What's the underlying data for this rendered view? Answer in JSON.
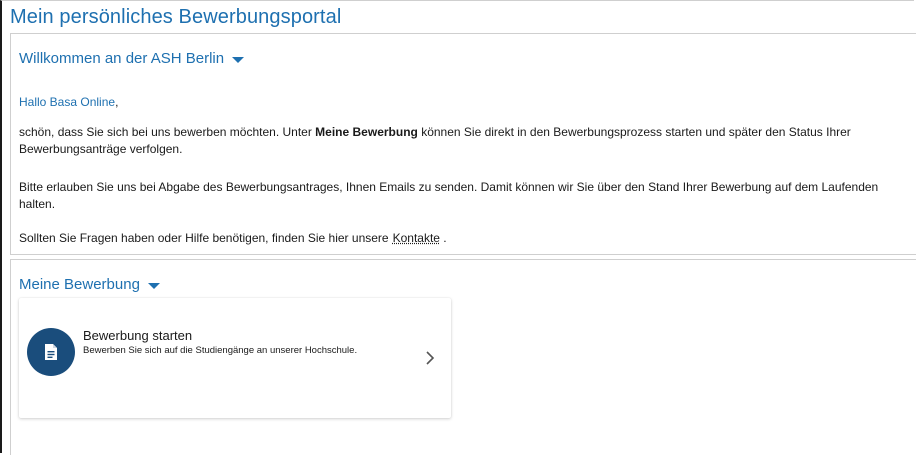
{
  "page": {
    "title": "Mein persönliches Bewerbungsportal"
  },
  "welcome": {
    "heading": "Willkommen an der ASH Berlin",
    "greeting_name": "Hallo Basa Online",
    "greeting_comma": ",",
    "p1_before": "schön, dass Sie sich bei uns bewerben möchten. Unter ",
    "p1_bold": "Meine Bewerbung",
    "p1_after": " können Sie direkt in den Bewerbungsprozess starten und später den Status Ihrer Bewerbungsanträge verfolgen.",
    "p2": "Bitte erlauben Sie uns bei Abgabe des Bewerbungsantrages, Ihnen Emails zu senden. Damit können wir Sie über den Stand Ihrer Bewerbung auf dem Laufenden halten.",
    "p3_before": "Sollten Sie Fragen haben oder Hilfe benötigen, finden Sie hier unsere",
    "p3_link": "Kontakte",
    "p3_after": " ."
  },
  "application": {
    "heading": "Meine Bewerbung",
    "card": {
      "title": "Bewerbung starten",
      "subtitle": "Bewerben Sie sich auf die Studiengänge an unserer Hochschule.",
      "icon": "document-icon",
      "arrow_icon": "chevron-right-icon"
    }
  },
  "colors": {
    "accent": "#1e70b0",
    "icon_bg": "#1a4d7c",
    "text": "#1a1a1a",
    "border": "#cfcfcf"
  }
}
